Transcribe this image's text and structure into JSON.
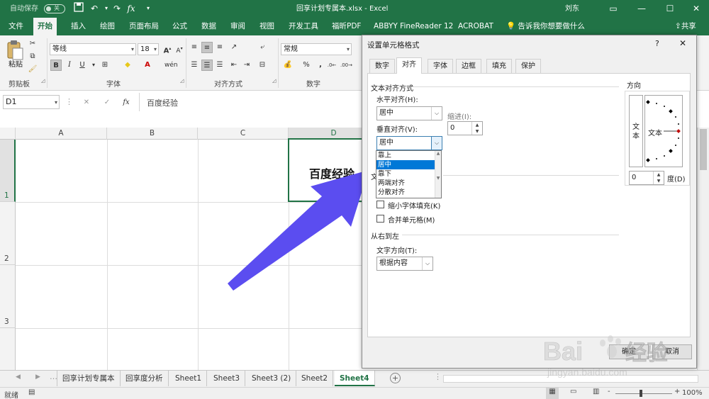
{
  "titlebar": {
    "autosave_label": "自动保存",
    "autosave_state": "关",
    "title": "回享计划专属本.xlsx  -  Excel",
    "user": "刘东",
    "fx": "fx"
  },
  "ribbon_tabs": [
    "文件",
    "开始",
    "插入",
    "绘图",
    "页面布局",
    "公式",
    "数据",
    "审阅",
    "视图",
    "开发工具",
    "福昕PDF",
    "ABBYY FineReader 12",
    "ACROBAT"
  ],
  "tell_me": "告诉我你想要做什么",
  "share": "共享",
  "ribbon": {
    "paste": "粘贴",
    "clipboard": "剪贴板",
    "font_name": "等线",
    "font_size": "18",
    "font_group": "字体",
    "align_group": "对齐方式",
    "number_format": "常规",
    "number_group": "数字",
    "bold": "B",
    "italic": "I",
    "underline": "U",
    "grow": "A",
    "shrink": "A",
    "percent": "%",
    "comma": ","
  },
  "formula_bar": {
    "namebox": "D1",
    "fx": "fx",
    "content": "百度经验"
  },
  "columns": [
    "A",
    "B",
    "C",
    "D"
  ],
  "rows": [
    "1",
    "2",
    "3"
  ],
  "cell_d1": "百度经验",
  "sheet_tabs": [
    "回享计划专属本",
    "回享度分析",
    "Sheet1",
    "Sheet3",
    "Sheet3 (2)",
    "Sheet2",
    "Sheet4"
  ],
  "active_sheet": "Sheet4",
  "status": {
    "ready": "就绪",
    "zoom": "100%",
    "minus": "-",
    "plus": "+"
  },
  "dialog": {
    "title": "设置单元格格式",
    "help": "?",
    "close": "✕",
    "tabs": [
      "数字",
      "对齐",
      "字体",
      "边框",
      "填充",
      "保护"
    ],
    "active_tab": "对齐",
    "text_alignment": "文本对齐方式",
    "horizontal_label": "水平对齐(H):",
    "horizontal_value": "居中",
    "indent_label": "缩进(I):",
    "indent_value": "0",
    "vertical_label": "垂直对齐(V):",
    "vertical_value": "居中",
    "vertical_options": [
      "靠上",
      "居中",
      "靠下",
      "两端对齐",
      "分散对齐"
    ],
    "vertical_highlight": "居中",
    "text_control_partial": "文",
    "shrink_to_fit": "缩小字体填充(K)",
    "merge_cells": "合并单元格(M)",
    "rtl_section": "从右到左",
    "text_direction_label": "文字方向(T):",
    "text_direction_value": "根据内容",
    "orientation": "方向",
    "orientation_vertical_text": "文\n本",
    "orientation_text": "文本",
    "degree_value": "0",
    "degree_label": "度(D)",
    "ok": "确定",
    "cancel": "取消"
  },
  "watermark": {
    "brand": "Baidu 经验",
    "url": "jingyan.baidu.com"
  },
  "colors": {
    "excel_green": "#217346",
    "arrow": "#5b4df0",
    "highlight": "#0078d7"
  }
}
